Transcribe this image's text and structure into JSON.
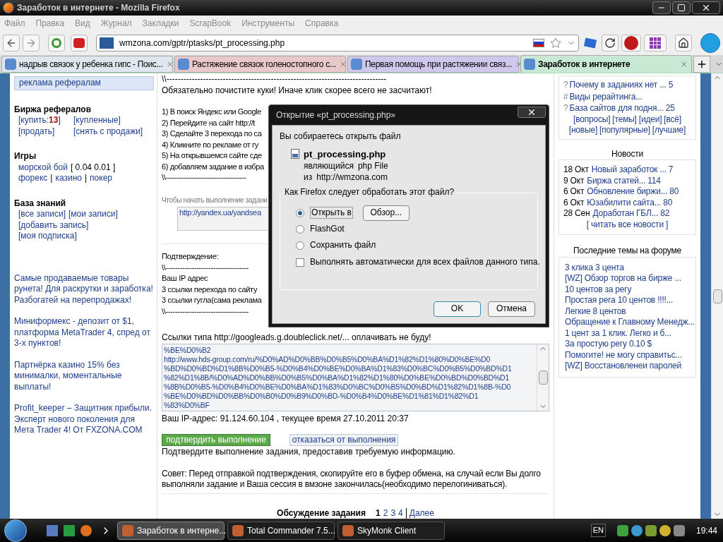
{
  "window": {
    "title": "Заработок в интернете - Mozilla Firefox"
  },
  "menu": [
    "Файл",
    "Правка",
    "Вид",
    "Журнал",
    "Закладки",
    "ScrapBook",
    "Инструменты",
    "Справка"
  ],
  "address_bar": {
    "url": "wmzona.com/gptr/ptasks/pt_processing.php"
  },
  "tabs": [
    {
      "label": "надрыв связок у ребенка гипс - Поис...",
      "selected": false,
      "color": "#dfe6ee"
    },
    {
      "label": "Растяжение связок голеностопного с...",
      "selected": false,
      "color": "#e8c8c8"
    },
    {
      "label": "Первая помощь при растяжении связ...",
      "selected": false,
      "color": "#cfc8ec"
    },
    {
      "label": "Заработок в интернете",
      "selected": true,
      "color": "#c8ead4"
    }
  ],
  "left": {
    "top_link": "реклама рефералам",
    "sections": [
      {
        "heading": "Биржа рефералов",
        "kind": "pairs",
        "lines": [
          {
            "items": [
              {
                "t": "[купить:**13**]",
                "link": true
              },
              {
                "t": "[купленные]",
                "link": true
              }
            ]
          },
          {
            "items": [
              {
                "t": "[продать]",
                "link": true
              },
              {
                "t": "[снять с продажи]",
                "link": true
              }
            ]
          }
        ]
      },
      {
        "heading": "Игры",
        "kind": "flow",
        "lines": [
          {
            "items": [
              {
                "t": "морской бой",
                "link": true
              },
              {
                "t": "[ 0.04 0.01 ]",
                "link": false
              }
            ]
          },
          {
            "items": [
              {
                "t": "форекс",
                "link": true
              },
              {
                "t": "|",
                "link": false
              },
              {
                "t": "казино",
                "link": true
              },
              {
                "t": "|",
                "link": false
              },
              {
                "t": "покер",
                "link": true
              }
            ]
          }
        ]
      },
      {
        "heading": "База знаний",
        "kind": "flow",
        "lines": [
          {
            "items": [
              {
                "t": "[все записи]",
                "link": true
              },
              {
                "t": "[мои записи]",
                "link": true
              }
            ]
          },
          {
            "items": [
              {
                "t": "[добавить запись]",
                "link": true
              }
            ]
          },
          {
            "items": [
              {
                "t": "[моя подписка]",
                "link": true
              }
            ]
          }
        ]
      }
    ],
    "ads": [
      "Самые продаваемые товары рунета! Для раскрутки и заработка! Разбогатей на перепродажах!",
      "Миниформекс - депозит от $1, платформа MetaTrader 4, спред от 3-х пунктов!",
      "Партнёрка казино 15% без минималки, моментальные выплаты!",
      "Profit_keeper – Защитник прибыли. Эксперт нового поколения для Мета Trader 4! От FXZONA.COM"
    ]
  },
  "task": {
    "top_lines": [
      "\\\\------------------------------------------------------------------------------",
      "Обязательно почистите куки! Иначе клик скорее всего не засчитают!"
    ],
    "steps": [
      "1) В поиск Яндекс или Google",
      "2) Перейдите на сайт http://t",
      "3) Сделайте 3 перехода по са",
      "4) Кликните по рекламе от гу",
      "5) На открывшемся сайте сде",
      "6) добавляем задание в избра",
      "\\\\-----------------------------------"
    ],
    "start_hint": "Чтобы начать выполнение задани",
    "start_url": "http://yandex.ua/yandsea",
    "confirm_lines": [
      "Подтверждение:",
      "\\\\-----------------------------------",
      "Ваш IP адрес",
      "3 ссылки перехода по сайту",
      "3 ссылки гугла(сама реклама",
      "\\\\-----------------------------------"
    ],
    "note": "Ссылки типа http://googleads.g.doubleclick.net/... оплачивать не буду!",
    "answer_lines": [
      "%BE%D0%B2",
      "http://www.hds-group.com/ru/%D0%AD%D0%BB%D0%B5%D0%BA%D1%82%D1%80%D0%BE%D0",
      "%BD%D0%BD%D1%8B%D0%B5-%D0%B4%D0%BE%D0%BA%D1%83%D0%BC%D0%B5%D0%BD%D1",
      "%82%D1%8B/%D0%AD%D0%BB%D0%B5%D0%BA%D1%82%D1%80%D0%BE%D0%BD%D0%BD%D1",
      "%8B%D0%B5-%D0%B4%D0%BE%D0%BA%D1%83%D0%BC%D0%B5%D0%BD%D1%82%D1%8B-%D0",
      "%BE%D0%BD%D0%BB%D0%B0%D0%B9%D0%BD-%D0%B4%D0%BE%D1%81%D1%82%D1",
      "%83%D0%BF"
    ],
    "ip_line": "Ваш IP-адрес: 91.124.60.104 , текущее время 27.10.2011 20:37",
    "confirm_button": "подтвердить выполнение",
    "refuse_button": "отказаться от выполнения",
    "confirm_help": "Подтвердите выполнение задания, предоставив требуемую информацию.",
    "advice": "Совет: Перед отправкой подтверждения, скопируйте его в буфер обмена, на случай если Вы долго выполняли задание и Ваша сессия в вмзоне закончилась(необходимо перелогиниваться).",
    "discussion": {
      "label": "Обсуждение задания",
      "pages": [
        {
          "label": "1",
          "selected": true
        },
        {
          "label": "2",
          "selected": false
        },
        {
          "label": "3",
          "selected": false
        },
        {
          "label": "4",
          "selected": false
        }
      ],
      "next": "Далее"
    }
  },
  "right": {
    "questions": [
      {
        "marker": "?",
        "text": "Почему в заданиях нет ... 5"
      },
      {
        "marker": "#",
        "text": "Виды рерайтинга..."
      },
      {
        "marker": "?",
        "text": "База сайтов для подня... 25"
      }
    ],
    "question_links": [
      {
        "items": [
          "[вопросы]",
          "[темы]",
          "[идеи]",
          "[всё]"
        ]
      },
      {
        "items": [
          "[новые]",
          "[популярные]",
          "[лучшие]"
        ]
      }
    ],
    "news_title": "Новости",
    "news": [
      {
        "date": "18 Окт",
        "title": "Новый заработок ... 7"
      },
      {
        "date": "9 Окт",
        "title": "Биржа статей... 114"
      },
      {
        "date": "6 Окт",
        "title": "Обновление биржи... 80"
      },
      {
        "date": "6 Окт",
        "title": "Юзабилити сайта... 80"
      },
      {
        "date": "28 Сен",
        "title": "Доработан ГБЛ... 82"
      }
    ],
    "all_news": "[ читать все новости ]",
    "forum_title": "Последние темы на форуме",
    "forum": [
      "3 клика 3 цента",
      "[WZ] Обзор торгов на бирже ...",
      "10 центов за регу",
      "Простая рега 10 центов !!!!...",
      "Легкие 8 центов",
      "Обращение к Главному Менедж...",
      "1 цент за 1 клик. Легко и б...",
      "За простую регу 0.10 $",
      "Помогите! не могу справитьс...",
      "[WZ] Восстановленеи паролей"
    ]
  },
  "dialog": {
    "title": "Открытие «pt_processing.php»",
    "intro": "Вы собираетесь открыть файл",
    "file_name": "pt_processing.php",
    "type_prefix": "являющийся",
    "type": "php File",
    "from_prefix": "из",
    "from": "http://wmzona.com",
    "question": "Как Firefox следует обработать этот файл?",
    "options": [
      {
        "label": "Открыть в",
        "selected": true,
        "kind": "browse"
      },
      {
        "label": "FlashGot",
        "selected": false,
        "kind": "plain"
      },
      {
        "label": "Сохранить файл",
        "selected": false,
        "kind": "plain"
      }
    ],
    "browse_button": "Обзор...",
    "auto": {
      "label": "Выполнять автоматически для всех файлов данного типа.",
      "checked": false
    },
    "ok": "OK",
    "cancel": "Отмена"
  },
  "taskbar": {
    "tasks": [
      {
        "label": "Заработок в интерне...",
        "selected": true
      },
      {
        "label": "Total Commander 7.5...",
        "selected": false
      },
      {
        "label": "SkyMonk Client",
        "selected": false
      }
    ],
    "language": "EN",
    "clock": "19:44"
  }
}
